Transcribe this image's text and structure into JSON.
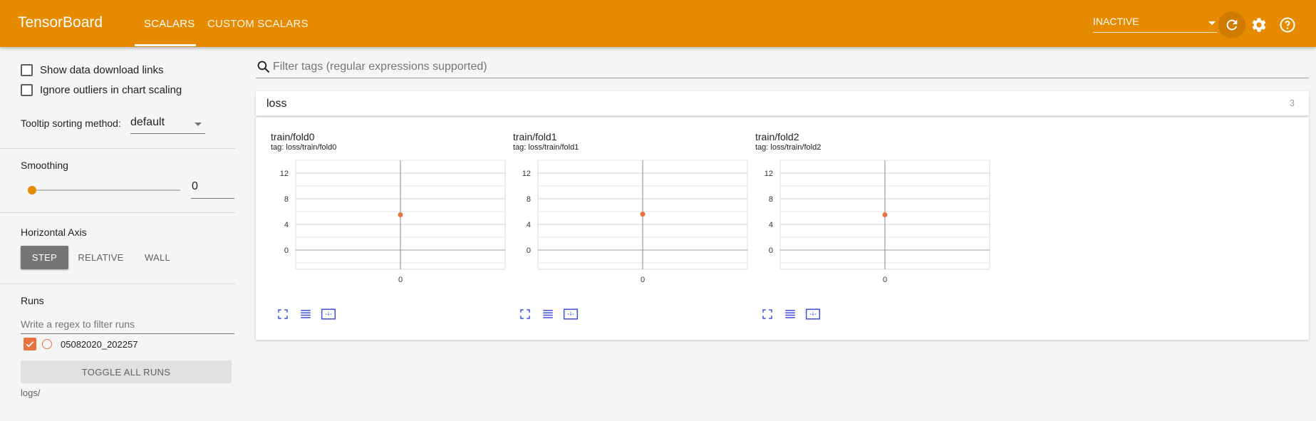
{
  "header": {
    "brand": "TensorBoard",
    "tabs": [
      {
        "label": "SCALARS",
        "active": true
      },
      {
        "label": "CUSTOM SCALARS",
        "active": false
      }
    ],
    "run_status": "INACTIVE",
    "icons": [
      "refresh-icon",
      "settings-gear-icon",
      "help-circle-icon"
    ]
  },
  "sidebar": {
    "options": [
      {
        "label": "Show data download links",
        "checked": false
      },
      {
        "label": "Ignore outliers in chart scaling",
        "checked": false
      }
    ],
    "tooltip_label": "Tooltip sorting method:",
    "tooltip_value": "default",
    "smoothing_label": "Smoothing",
    "smoothing_value": "0",
    "axis_label": "Horizontal Axis",
    "axis_options": [
      {
        "label": "STEP",
        "active": true
      },
      {
        "label": "RELATIVE",
        "active": false
      },
      {
        "label": "WALL",
        "active": false
      }
    ],
    "runs_label": "Runs",
    "runs_filter_placeholder": "Write a regex to filter runs",
    "runs": [
      {
        "name": "05082020_202257",
        "checked": true,
        "color": "#e8733e"
      }
    ],
    "toggle_all_label": "TOGGLE ALL RUNS",
    "logdir": "logs/"
  },
  "main": {
    "filter_placeholder": "Filter tags (regular expressions supported)",
    "category": {
      "name": "loss",
      "count": "3"
    }
  },
  "chart_data": [
    {
      "type": "scatter",
      "title": "train/fold0",
      "subtitle": "tag: loss/train/fold0",
      "x_ticks": [
        "0"
      ],
      "y_ticks": [
        "0",
        "4",
        "8",
        "12"
      ],
      "ylim": [
        -1,
        14
      ],
      "points": [
        {
          "x": 0,
          "y": 5.5
        }
      ],
      "grid": true
    },
    {
      "type": "scatter",
      "title": "train/fold1",
      "subtitle": "tag: loss/train/fold1",
      "x_ticks": [
        "0"
      ],
      "y_ticks": [
        "0",
        "4",
        "8",
        "12"
      ],
      "ylim": [
        -1,
        14
      ],
      "points": [
        {
          "x": 0,
          "y": 5.6
        }
      ],
      "grid": true
    },
    {
      "type": "scatter",
      "title": "train/fold2",
      "subtitle": "tag: loss/train/fold2",
      "x_ticks": [
        "0"
      ],
      "y_ticks": [
        "0",
        "4",
        "8",
        "12"
      ],
      "ylim": [
        -1,
        14
      ],
      "points": [
        {
          "x": 0,
          "y": 5.5
        }
      ],
      "grid": true
    }
  ],
  "colors": {
    "header": "#e68a00",
    "run": "#e8733e",
    "tool_icons": "#3f51e0"
  }
}
